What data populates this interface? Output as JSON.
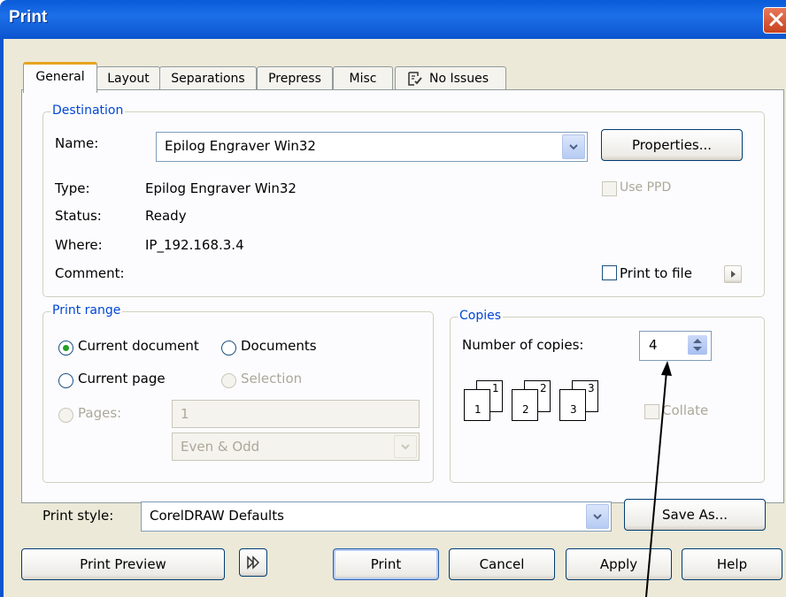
{
  "window": {
    "title": "Print"
  },
  "tabs": [
    "General",
    "Layout",
    "Separations",
    "Prepress",
    "Misc",
    "No Issues"
  ],
  "destination": {
    "title": "Destination",
    "name_label": "Name:",
    "name_value": "Epilog Engraver Win32",
    "properties_button": "Properties...",
    "type_label": "Type:",
    "type_value": "Epilog Engraver Win32",
    "status_label": "Status:",
    "status_value": "Ready",
    "where_label": "Where:",
    "where_value": "IP_192.168.3.4",
    "comment_label": "Comment:",
    "use_ppd_label": "Use PPD",
    "print_to_file_label": "Print to file"
  },
  "print_range": {
    "title": "Print range",
    "current_document": "Current document",
    "documents": "Documents",
    "current_page": "Current page",
    "selection": "Selection",
    "pages_label": "Pages:",
    "pages_value": "1",
    "even_odd_value": "Even & Odd"
  },
  "copies": {
    "title": "Copies",
    "number_label": "Number of copies:",
    "number_value": "4",
    "collate_label": "Collate",
    "icon_labels": [
      "1",
      "1",
      "2",
      "2",
      "3",
      "3"
    ]
  },
  "print_style": {
    "label": "Print style:",
    "value": "CorelDRAW Defaults",
    "save_as_button": "Save As..."
  },
  "buttons": {
    "print_preview": "Print Preview",
    "print": "Print",
    "cancel": "Cancel",
    "apply": "Apply",
    "help": "Help"
  },
  "colors": {
    "titlebar": "#0a5bd8",
    "group_title": "#0046d5",
    "dialog_bg": "#ece9d8",
    "active_tab_accent": "#e6a51f",
    "radio_selected": "#21a121"
  }
}
